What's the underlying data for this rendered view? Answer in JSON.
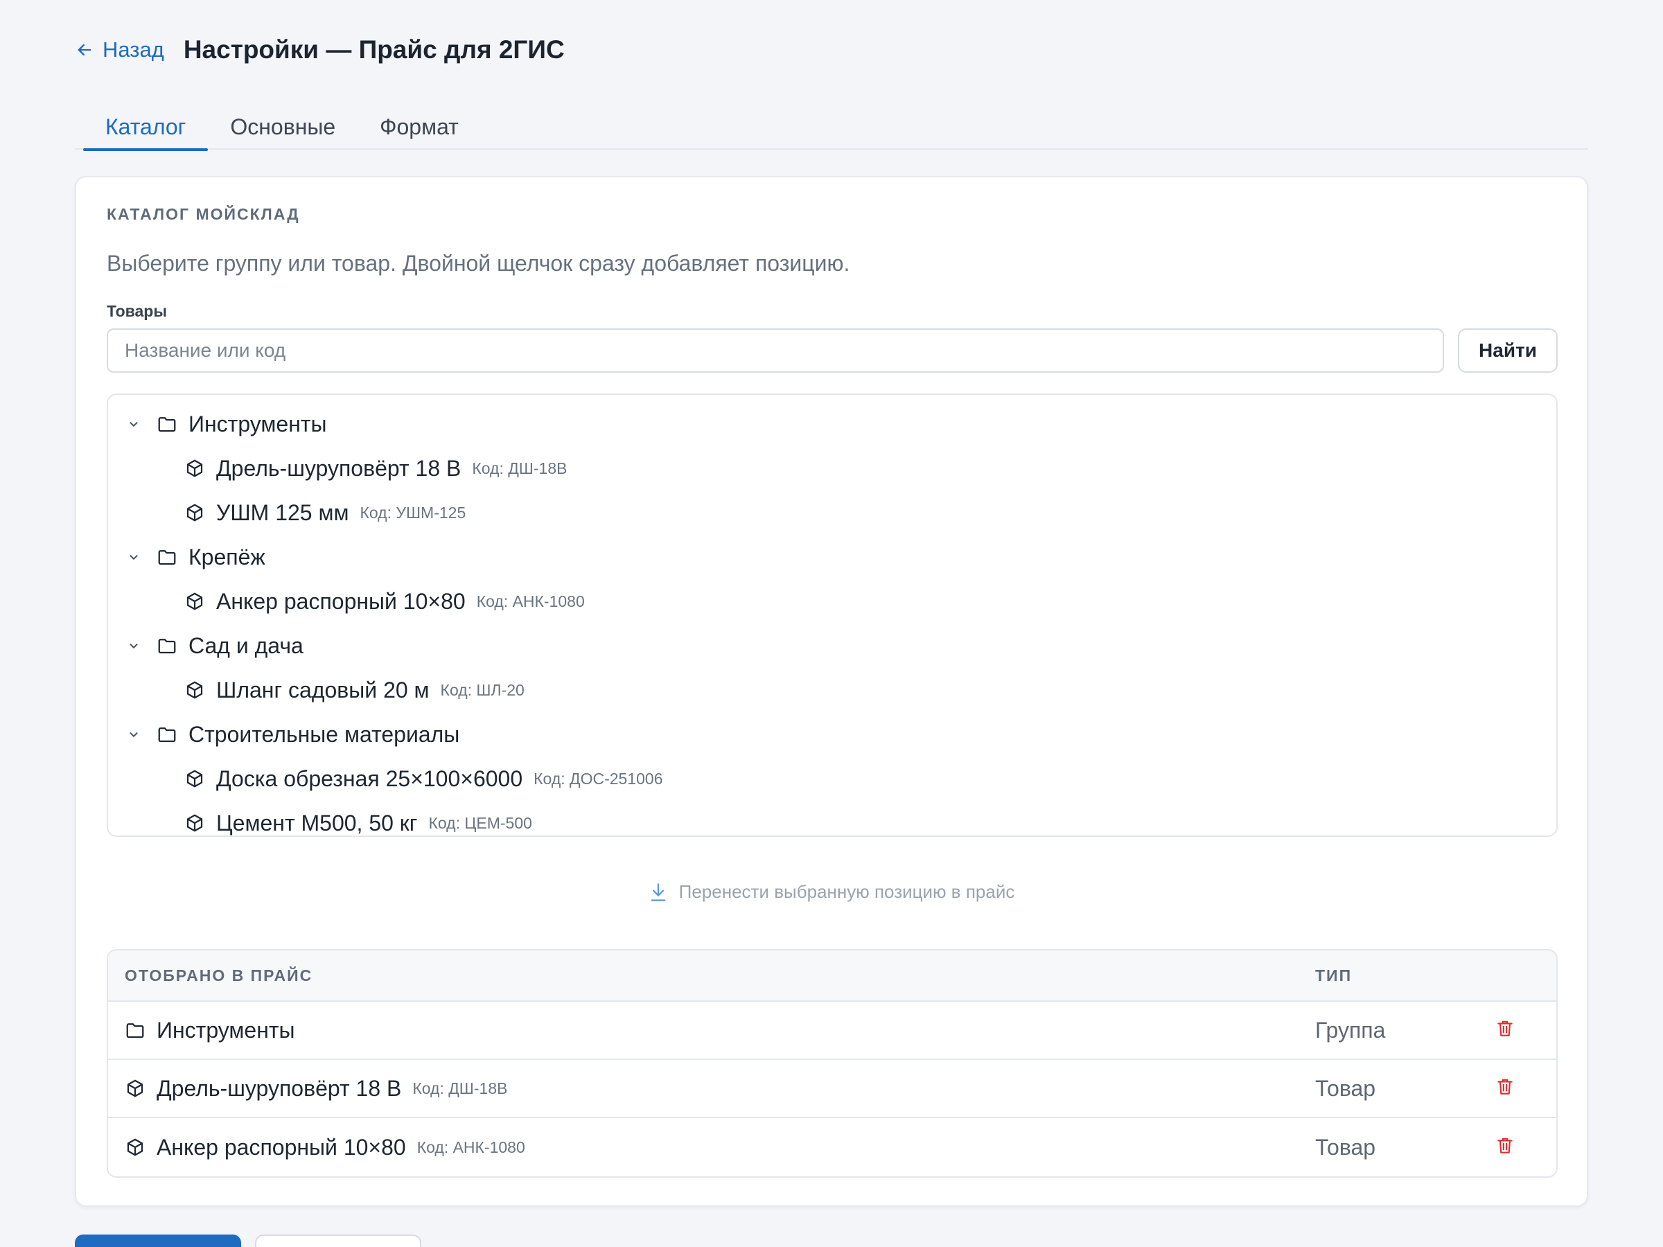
{
  "header": {
    "back_label": "Назад",
    "title": "Настройки — Прайс для 2ГИС"
  },
  "tabs": [
    {
      "label": "Каталог",
      "active": true
    },
    {
      "label": "Основные",
      "active": false
    },
    {
      "label": "Формат",
      "active": false
    }
  ],
  "catalog": {
    "section_title": "КАТАЛОГ МОЙСКЛАД",
    "hint": "Выберите группу или товар. Двойной щелчок сразу добавляет позицию.",
    "products_label": "Товары",
    "search_placeholder": "Название или код",
    "search_value": "",
    "find_button": "Найти",
    "tree": [
      {
        "kind": "group",
        "label": "Инструменты",
        "icon": "folder-icon",
        "expanded": true
      },
      {
        "kind": "item",
        "label": "Дрель-шуруповёрт 18 В",
        "code": "Код: ДШ-18В",
        "icon": "package-icon"
      },
      {
        "kind": "item",
        "label": "УШМ 125 мм",
        "code": "Код: УШМ-125",
        "icon": "package-icon"
      },
      {
        "kind": "group",
        "label": "Крепёж",
        "icon": "folder-icon",
        "expanded": true
      },
      {
        "kind": "item",
        "label": "Анкер распорный 10×80",
        "code": "Код: АНК-1080",
        "icon": "package-icon"
      },
      {
        "kind": "group",
        "label": "Сад и дача",
        "icon": "folder-icon",
        "expanded": true
      },
      {
        "kind": "item",
        "label": "Шланг садовый 20 м",
        "code": "Код: ШЛ-20",
        "icon": "package-icon"
      },
      {
        "kind": "group",
        "label": "Строительные материалы",
        "icon": "folder-icon",
        "expanded": true
      },
      {
        "kind": "item",
        "label": "Доска обрезная 25×100×6000",
        "code": "Код: ДОС-251006",
        "icon": "package-icon"
      },
      {
        "kind": "item",
        "label": "Цемент М500, 50 кг",
        "code": "Код: ЦЕМ-500",
        "icon": "package-icon"
      }
    ],
    "transfer_label": "Перенести выбранную позицию в прайс"
  },
  "selected": {
    "col_name": "ОТОБРАНО В ПРАЙС",
    "col_type": "ТИП",
    "rows": [
      {
        "label": "Инструменты",
        "code": "",
        "type": "Группа",
        "icon": "folder-icon"
      },
      {
        "label": "Дрель-шуруповёрт 18 В",
        "code": "Код: ДШ-18В",
        "type": "Товар",
        "icon": "package-icon"
      },
      {
        "label": "Анкер распорный 10×80",
        "code": "Код: АНК-1080",
        "type": "Товар",
        "icon": "package-icon"
      }
    ]
  },
  "colors": {
    "accent": "#1e6bbf",
    "danger": "#d93030",
    "text": "#1f2733",
    "muted": "#66717f"
  }
}
